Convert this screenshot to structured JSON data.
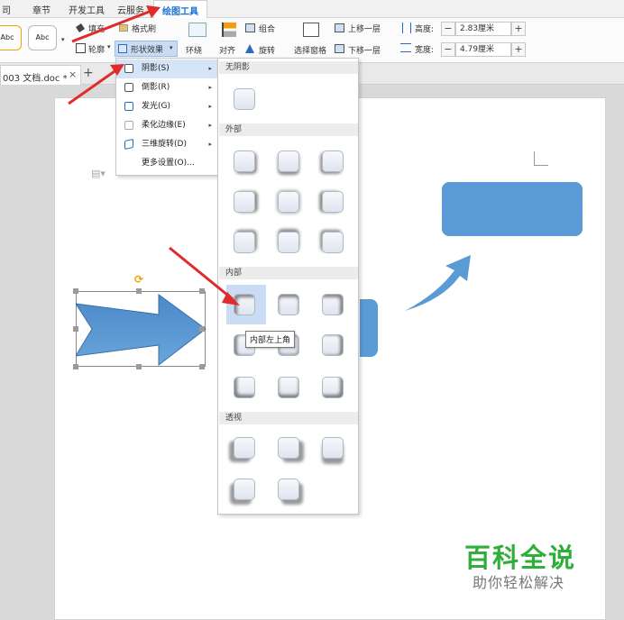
{
  "menubar": {
    "items": [
      {
        "label": "司",
        "active": false
      },
      {
        "label": "章节",
        "active": false
      },
      {
        "label": "开发工具",
        "active": false
      },
      {
        "label": "云服务",
        "active": false
      },
      {
        "label": "绘图工具",
        "active": true
      }
    ]
  },
  "ribbon": {
    "styles": [
      "Abc",
      "Abc"
    ],
    "fill_label": "填充",
    "format_painter_label": "格式刷",
    "outline_label": "轮廓",
    "shape_effect_label": "形状效果",
    "wrap_label": "环绕",
    "align_label": "对齐",
    "group_label": "组合",
    "rotate_label": "旋转",
    "selection_pane_label": "选择窗格",
    "bring_forward_label": "上移一层",
    "send_backward_label": "下移一层",
    "height_label": "高度:",
    "height_value": "2.83厘米",
    "width_label": "宽度:",
    "width_value": "4.79厘米",
    "minus": "−",
    "plus": "+"
  },
  "tabbar": {
    "doc_tab_label": "003 文档.doc *",
    "close": "×",
    "new_tab": "+"
  },
  "effects_menu": {
    "items": [
      {
        "label": "阴影(S)",
        "has_submenu": true,
        "highlighted": true
      },
      {
        "label": "倒影(R)",
        "has_submenu": true,
        "highlighted": false
      },
      {
        "label": "发光(G)",
        "has_submenu": true,
        "highlighted": false
      },
      {
        "label": "柔化边缘(E)",
        "has_submenu": true,
        "highlighted": false
      },
      {
        "label": "三维旋转(D)",
        "has_submenu": true,
        "highlighted": false
      },
      {
        "label": "更多设置(O)...",
        "has_submenu": false,
        "highlighted": false
      }
    ],
    "arrow": "▸"
  },
  "shadow_submenu": {
    "sections": {
      "none": "无阴影",
      "outer": "外部",
      "inner": "内部",
      "perspective": "透视"
    },
    "tooltip": "内部左上角"
  },
  "watermark": {
    "title": "百科全说",
    "subtitle": "助你轻松解决"
  },
  "colors": {
    "accent_blue": "#5b9bd5",
    "arrow_red": "#e02b2b",
    "watermark_green": "#2fae3a"
  }
}
